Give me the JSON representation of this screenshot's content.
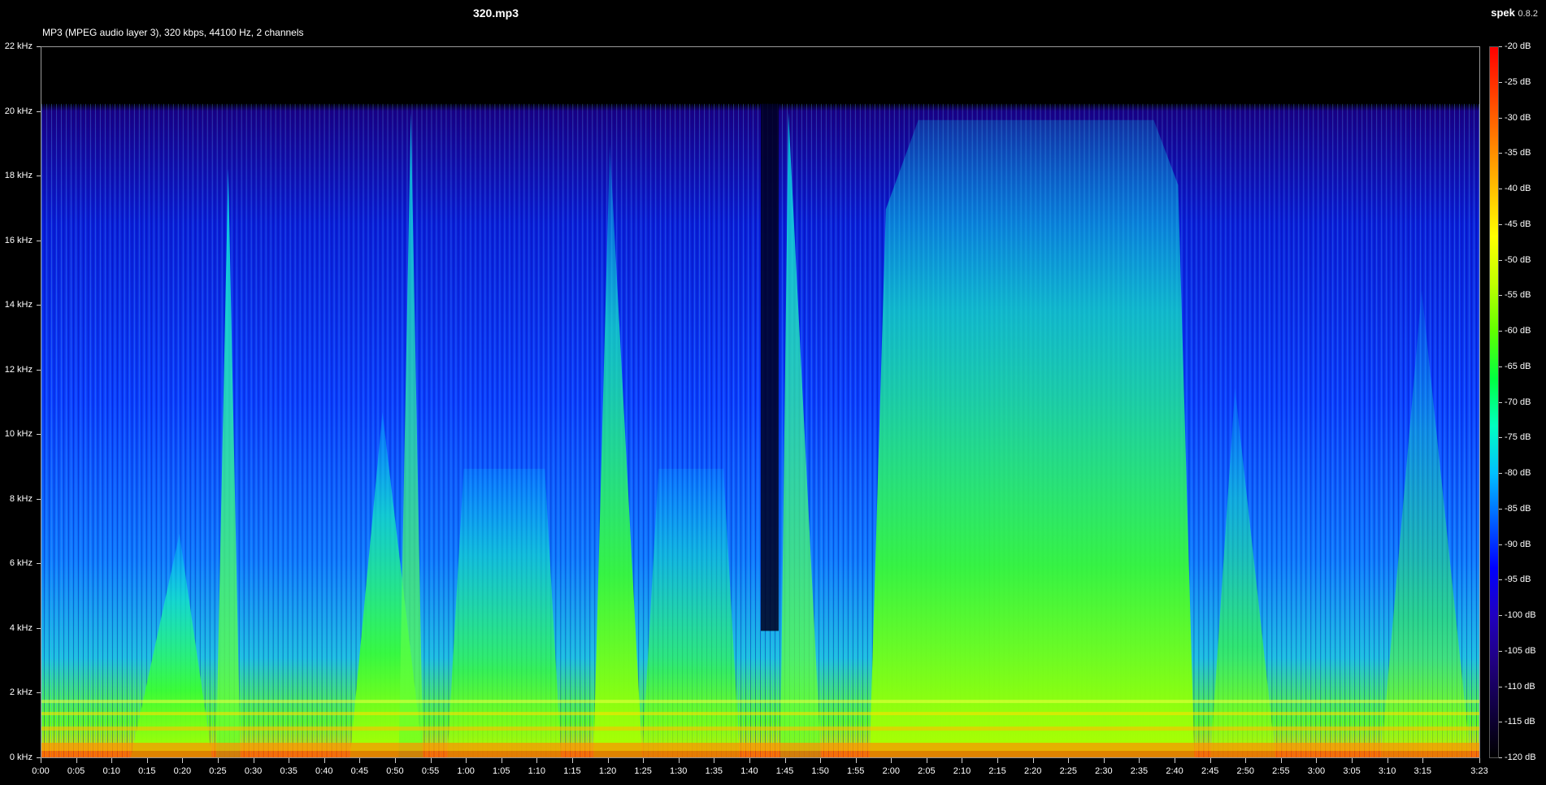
{
  "file": {
    "name": "320.mp3",
    "info": "MP3 (MPEG audio layer 3), 320 kbps, 44100 Hz, 2 channels"
  },
  "app": {
    "name": "spek",
    "version": "0.8.2"
  },
  "frequency_axis": {
    "unit": "kHz",
    "max_khz": 22,
    "ticks": [
      "22 kHz",
      "20 kHz",
      "18 kHz",
      "16 kHz",
      "14 kHz",
      "12 kHz",
      "10 kHz",
      "8 kHz",
      "6 kHz",
      "4 kHz",
      "2 kHz",
      "0 kHz"
    ]
  },
  "time_axis": {
    "duration_seconds": 203,
    "ticks": [
      "0:00",
      "0:05",
      "0:10",
      "0:15",
      "0:20",
      "0:25",
      "0:30",
      "0:35",
      "0:40",
      "0:45",
      "0:50",
      "0:55",
      "1:00",
      "1:05",
      "1:10",
      "1:15",
      "1:20",
      "1:25",
      "1:30",
      "1:35",
      "1:40",
      "1:45",
      "1:50",
      "1:55",
      "2:00",
      "2:05",
      "2:10",
      "2:15",
      "2:20",
      "2:25",
      "2:30",
      "2:35",
      "2:40",
      "2:45",
      "2:50",
      "2:55",
      "3:00",
      "3:05",
      "3:10",
      "3:15",
      "3:23"
    ]
  },
  "db_scale": {
    "min_db": -120,
    "max_db": -20,
    "ticks": [
      "-20 dB",
      "-25 dB",
      "-30 dB",
      "-35 dB",
      "-40 dB",
      "-45 dB",
      "-50 dB",
      "-55 dB",
      "-60 dB",
      "-65 dB",
      "-70 dB",
      "-75 dB",
      "-80 dB",
      "-85 dB",
      "-90 dB",
      "-95 dB",
      "-100 dB",
      "-105 dB",
      "-110 dB",
      "-115 dB",
      "-120 dB"
    ],
    "gradient_colors": [
      "#ff0000",
      "#ff4000",
      "#ff8000",
      "#ffc000",
      "#ffff00",
      "#c0ff00",
      "#60ff00",
      "#00ff40",
      "#00ffc0",
      "#00c0ff",
      "#0060ff",
      "#0000ff",
      "#2000c0",
      "#200080",
      "#100040",
      "#000000"
    ]
  },
  "colors": {
    "background": "#000000",
    "frame_border": "#9a9a9a",
    "text": "#ffffff"
  }
}
